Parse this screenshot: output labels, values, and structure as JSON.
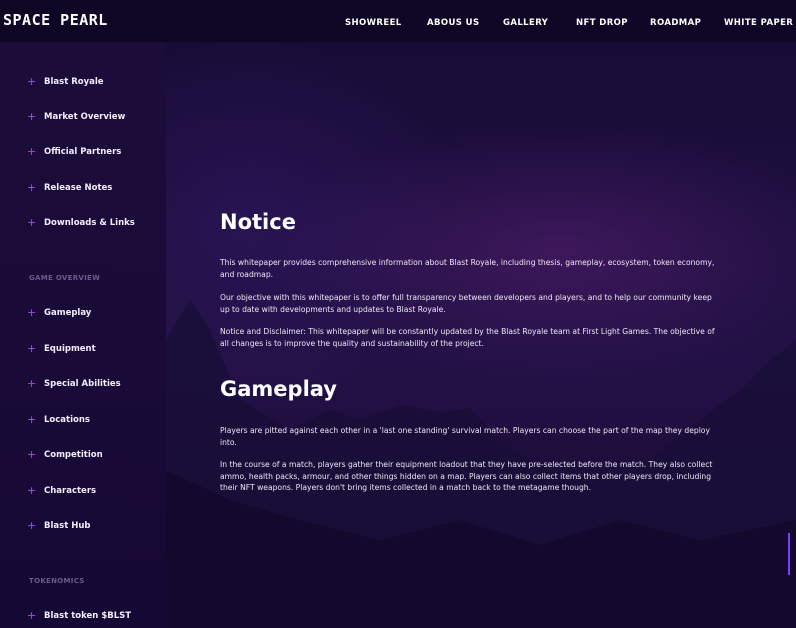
{
  "header": {
    "logo": "SPACE PEARL",
    "nav": [
      "SHOWREEL",
      "ABOUS US",
      "GALLERY",
      "NFT DROP",
      "ROADMAP",
      "WHITE PAPER"
    ]
  },
  "sidebar": {
    "group1": [
      "Blast Royale",
      "Market Overview",
      "Official Partners",
      "Release Notes",
      "Downloads & Links"
    ],
    "section_game": "GAME OVERVIEW",
    "group2": [
      "Gameplay",
      "Equipment",
      "Special Abilities",
      "Locations",
      "Competition",
      "Characters",
      "Blast Hub"
    ],
    "section_tokenomics": "TOKENOMICS",
    "group3": [
      "Blast token $BLST"
    ],
    "plus_icon": "+"
  },
  "content": {
    "notice_title": "Notice",
    "notice_p1": "This whitepaper provides comprehensive information about Blast Royale, including thesis, gameplay, ecosystem, token economy, and roadmap.",
    "notice_p2": "Our objective with this whitepaper is to offer full transparency between developers and players, and to help our community keep up to date with developments and updates to Blast Royale.",
    "notice_p3": "Notice and Disclaimer: This whitepaper will be constantly updated by the Blast Royale team at First Light Games. The objective of all changes is to improve the quality and sustainability of the project.",
    "gameplay_title": "Gameplay",
    "gameplay_p1": "Players are pitted against each other in a 'last one standing' survival match. Players can choose the part of the map they deploy into.",
    "gameplay_p2": "In the course of a match, players gather their equipment loadout that they have pre-selected before the match. They also collect ammo, health packs, armour, and other things hidden on a map. Players can also collect items that other players drop, including their NFT weapons. Players don't bring items collected in a match back to the metagame though."
  },
  "colors": {
    "accent": "#9f4cff",
    "background": "#170b35",
    "sidebar": "#1c0c3a"
  }
}
